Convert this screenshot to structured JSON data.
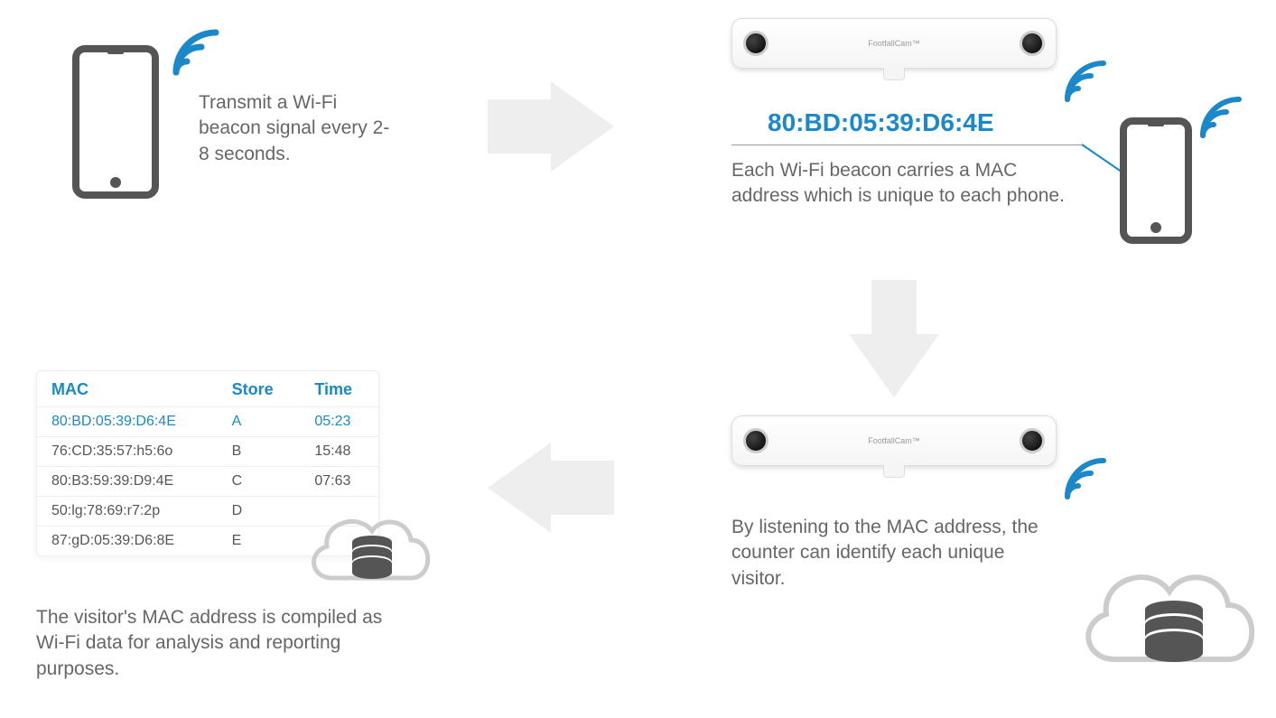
{
  "step1": {
    "desc": "Transmit a Wi-Fi beacon signal every 2-8 seconds."
  },
  "step2": {
    "mac": "80:BD:05:39:D6:4E",
    "desc": "Each Wi-Fi beacon carries a MAC address which is unique to each phone.",
    "brand": "FootfallCam™"
  },
  "step3": {
    "desc": "By listening to the MAC address, the counter can identify each unique visitor.",
    "brand": "FootfallCam™"
  },
  "step4": {
    "desc": "The visitor's MAC address is compiled as Wi-Fi data for analysis and reporting purposes.",
    "headers": {
      "mac": "MAC",
      "store": "Store",
      "time": "Time"
    },
    "rows": [
      {
        "mac": "80:BD:05:39:D6:4E",
        "store": "A",
        "time": "05:23",
        "highlight": true
      },
      {
        "mac": "76:CD:35:57:h5:6o",
        "store": "B",
        "time": "15:48"
      },
      {
        "mac": "80:B3:59:39:D9:4E",
        "store": "C",
        "time": "07:63"
      },
      {
        "mac": "50:lg:78:69:r7:2p",
        "store": "D",
        "time": ""
      },
      {
        "mac": "87:gD:05:39:D6:8E",
        "store": "E",
        "time": ""
      }
    ]
  }
}
